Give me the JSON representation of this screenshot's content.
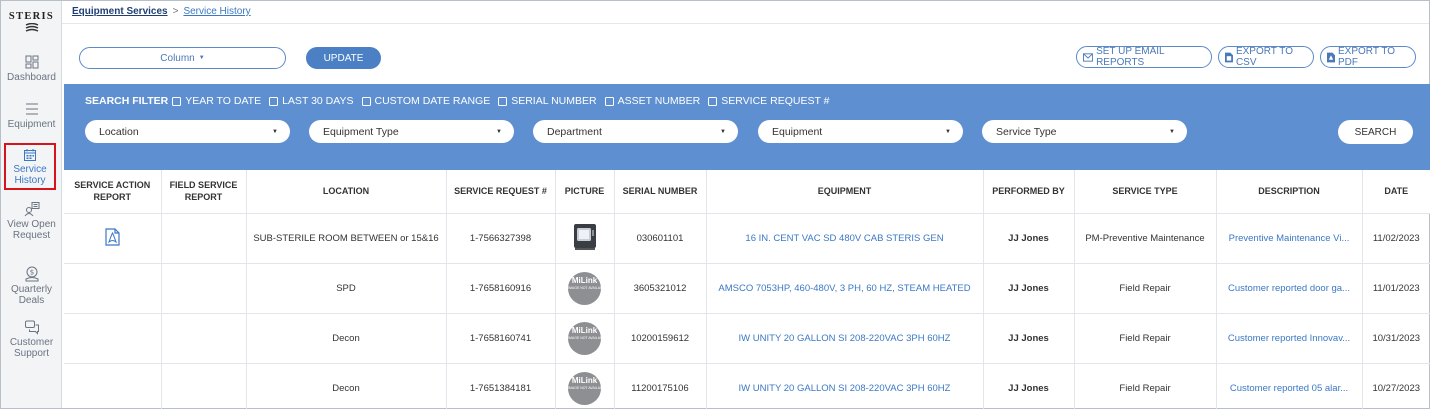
{
  "brand": {
    "name": "STERIS"
  },
  "sidebar": {
    "items": [
      {
        "label": "Dashboard",
        "icon": "dashboard-icon",
        "active": false
      },
      {
        "label": "Equipment",
        "icon": "list-icon",
        "active": false
      },
      {
        "label": "Service History",
        "icon": "calendar-icon",
        "active": true
      },
      {
        "label": "View Open Request",
        "icon": "person-request-icon",
        "active": false
      },
      {
        "label": "Quarterly Deals",
        "icon": "dollar-badge-icon",
        "active": false
      },
      {
        "label": "Customer Support",
        "icon": "chat-icon",
        "active": false
      }
    ]
  },
  "breadcrumb": {
    "parent": "Equipment Services",
    "separator": ">",
    "current": "Service History"
  },
  "toolbar": {
    "column_select": "Column",
    "update_label": "UPDATE",
    "email_reports_label": "SET UP EMAIL REPORTS",
    "export_csv_label": "EXPORT TO CSV",
    "export_pdf_label": "EXPORT TO PDF"
  },
  "filters": {
    "title": "SEARCH FILTER",
    "checkboxes": [
      "YEAR TO DATE",
      "LAST 30 DAYS",
      "CUSTOM DATE RANGE",
      "SERIAL NUMBER",
      "ASSET NUMBER",
      "SERVICE REQUEST #"
    ],
    "dropdowns": [
      "Location",
      "Equipment Type",
      "Department",
      "Equipment",
      "Service Type"
    ],
    "search_label": "SEARCH"
  },
  "table": {
    "columns": [
      "SERVICE ACTION REPORT",
      "FIELD SERVICE REPORT",
      "LOCATION",
      "SERVICE REQUEST #",
      "PICTURE",
      "SERIAL NUMBER",
      "EQUIPMENT",
      "PERFORMED BY",
      "SERVICE TYPE",
      "DESCRIPTION",
      "DATE"
    ],
    "picture_placeholder": {
      "title": "MiLink",
      "subtitle": "IMAGE NOT AVAILABLE"
    },
    "rows": [
      {
        "location": "SUB-STERILE ROOM BETWEEN or 15&16",
        "request": "1-7566327398",
        "serial": "030601101",
        "equipment": "16 IN. CENT VAC SD 480V CAB STERIS GEN",
        "performed_by": "JJ Jones",
        "service_type": "PM-Preventive Maintenance",
        "description": "Preventive Maintenance Vi...",
        "date": "11/02/2023",
        "has_pdf": true,
        "picture": "device"
      },
      {
        "location": "SPD",
        "request": "1-7658160916",
        "serial": "3605321012",
        "equipment": "AMSCO 7053HP, 460-480V, 3 PH, 60 HZ, STEAM HEATED",
        "performed_by": "JJ Jones",
        "service_type": "Field Repair",
        "description": "Customer reported door ga...",
        "date": "11/01/2023",
        "has_pdf": false,
        "picture": "placeholder"
      },
      {
        "location": "Decon",
        "request": "1-7658160741",
        "serial": "10200159612",
        "equipment": "IW UNITY 20 GALLON SI 208-220VAC 3PH 60HZ",
        "performed_by": "JJ Jones",
        "service_type": "Field Repair",
        "description": "Customer reported Innovav...",
        "date": "10/31/2023",
        "has_pdf": false,
        "picture": "placeholder"
      },
      {
        "location": "Decon",
        "request": "1-7651384181",
        "serial": "11200175106",
        "equipment": "IW UNITY 20 GALLON SI 208-220VAC 3PH 60HZ",
        "performed_by": "JJ Jones",
        "service_type": "Field Repair",
        "description": "Customer reported 05 alar...",
        "date": "10/27/2023",
        "has_pdf": false,
        "picture": "placeholder"
      }
    ]
  },
  "colors": {
    "accent": "#5e8fd1",
    "link": "#3b78c4",
    "active_outline": "#d7141b",
    "button": "#4b80c5"
  }
}
